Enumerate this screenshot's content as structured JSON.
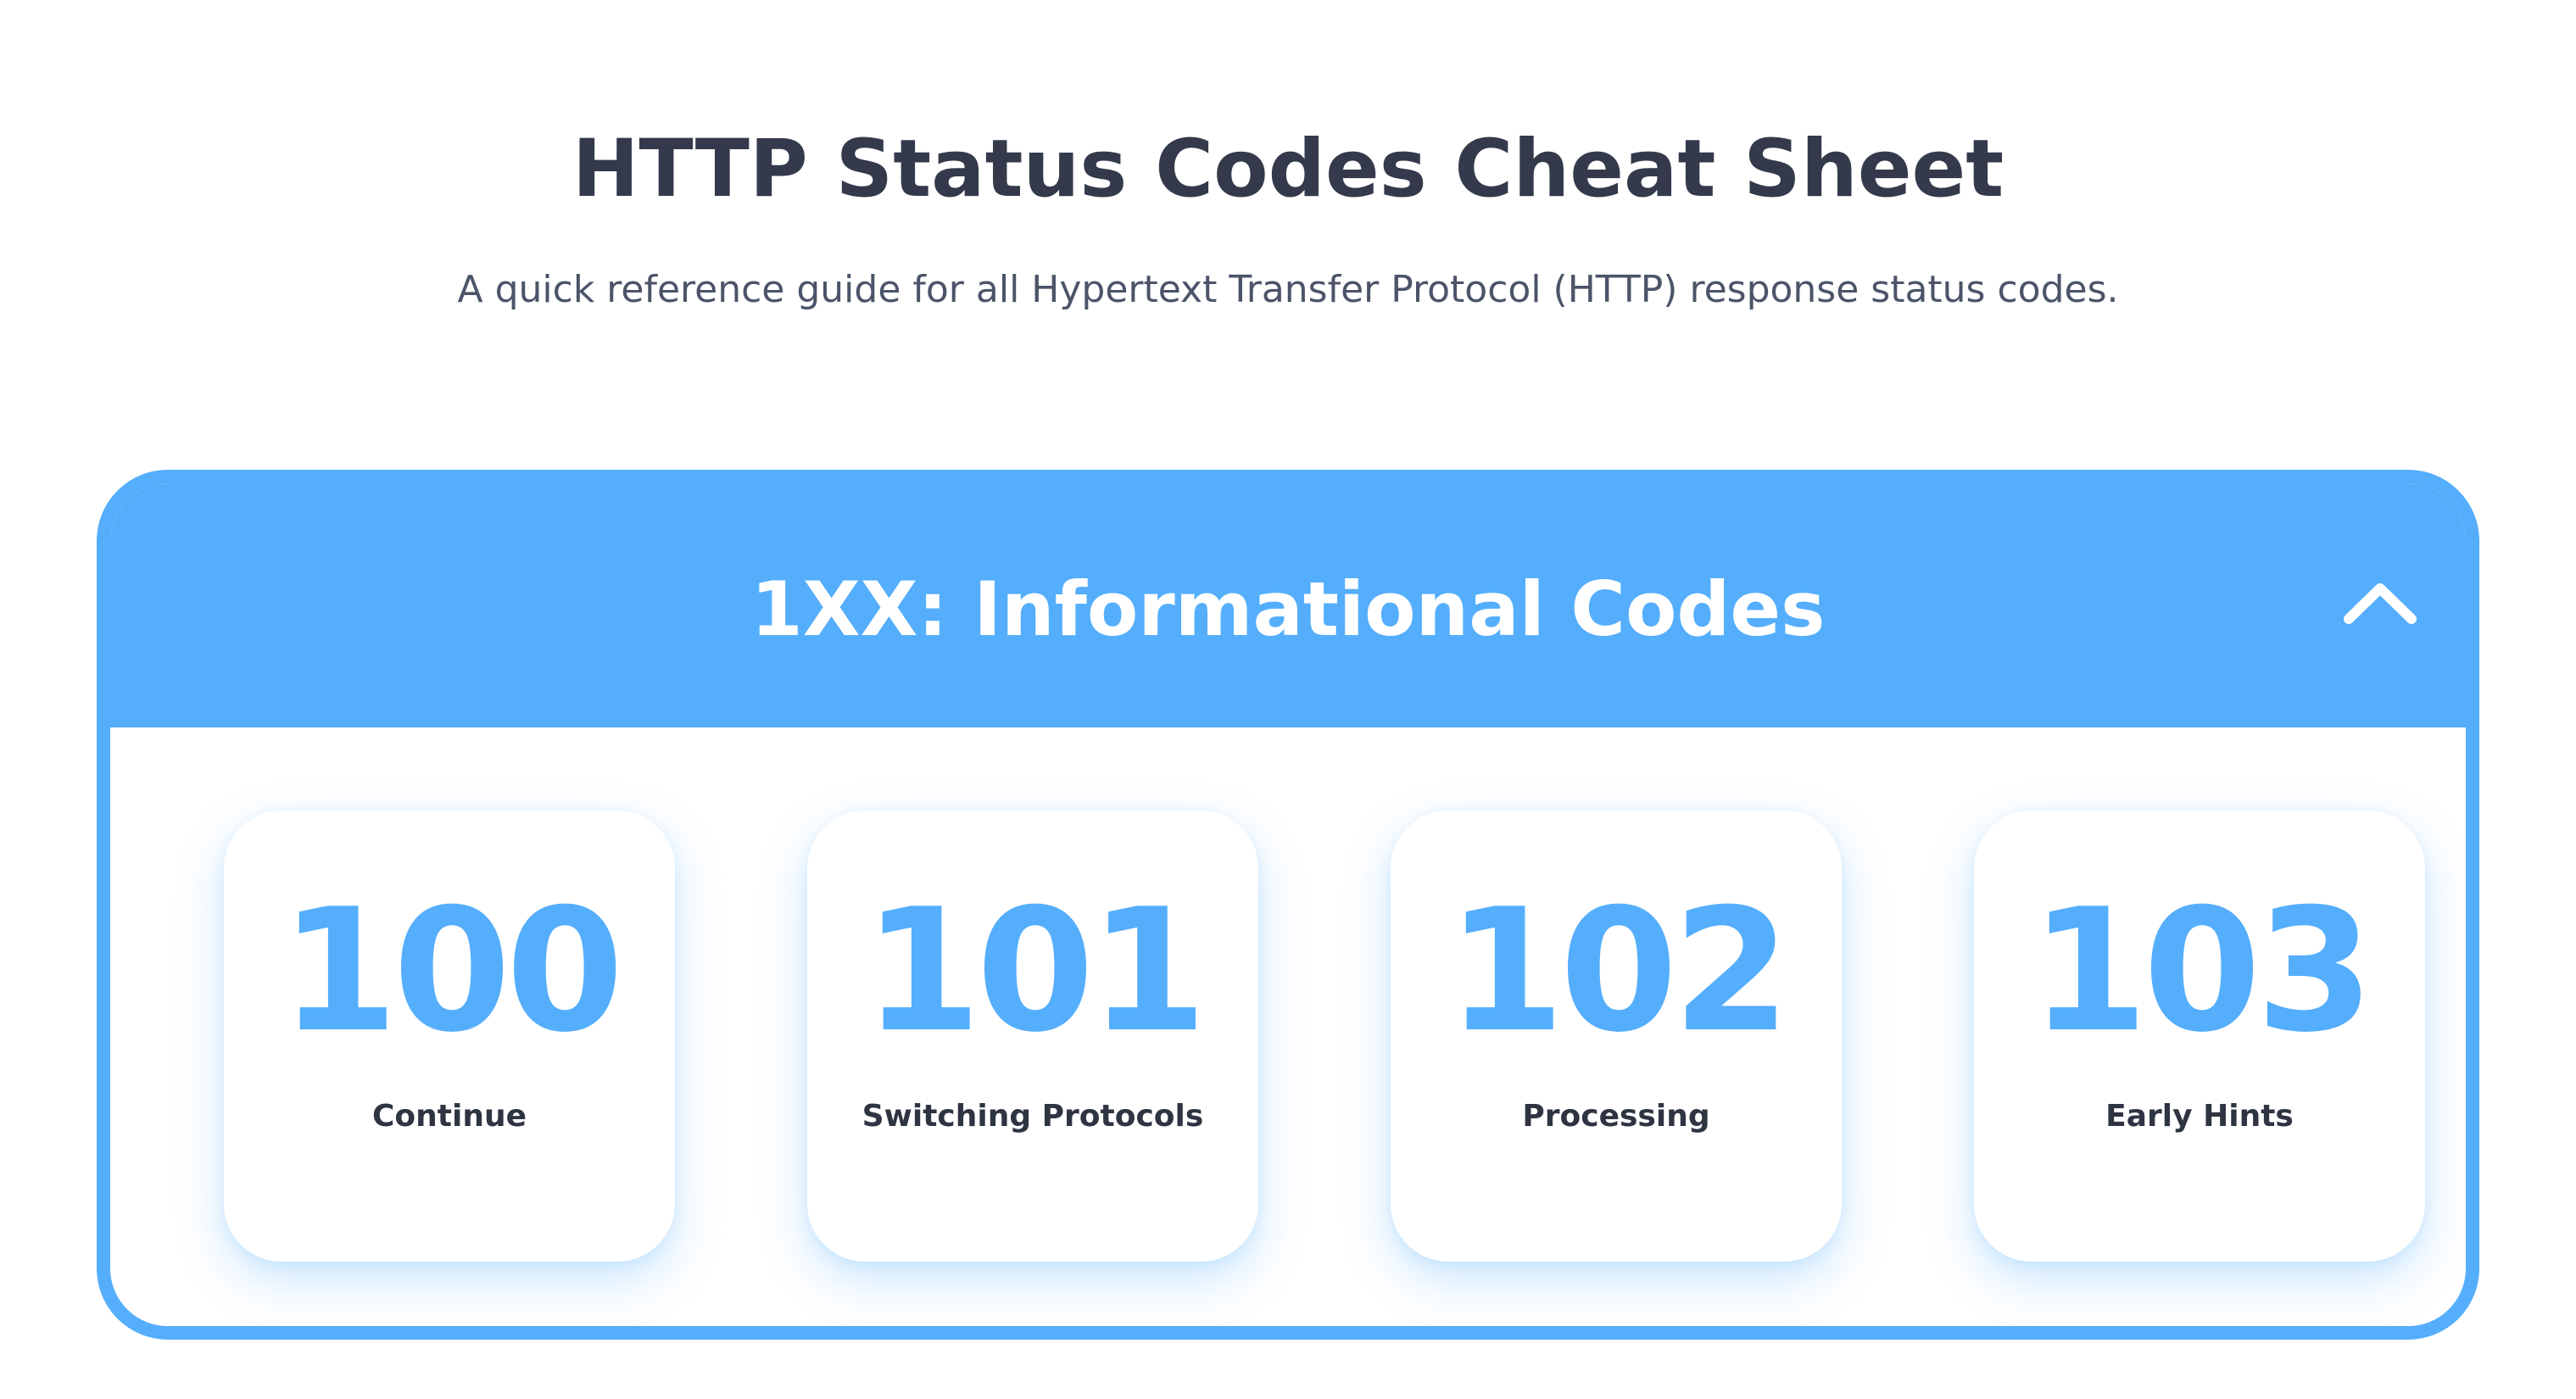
{
  "header": {
    "title": "HTTP Status Codes Cheat Sheet",
    "subtitle": "A quick reference guide for all Hypertext Transfer Protocol (HTTP) response status codes."
  },
  "section": {
    "title": "1XX: Informational Codes",
    "toggle_icon": "chevron-up-icon",
    "expanded": true,
    "accent_color": "#55aefc",
    "cards": [
      {
        "code": "100",
        "label": "Continue"
      },
      {
        "code": "101",
        "label": "Switching Protocols"
      },
      {
        "code": "102",
        "label": "Processing"
      },
      {
        "code": "103",
        "label": "Early Hints"
      }
    ]
  }
}
